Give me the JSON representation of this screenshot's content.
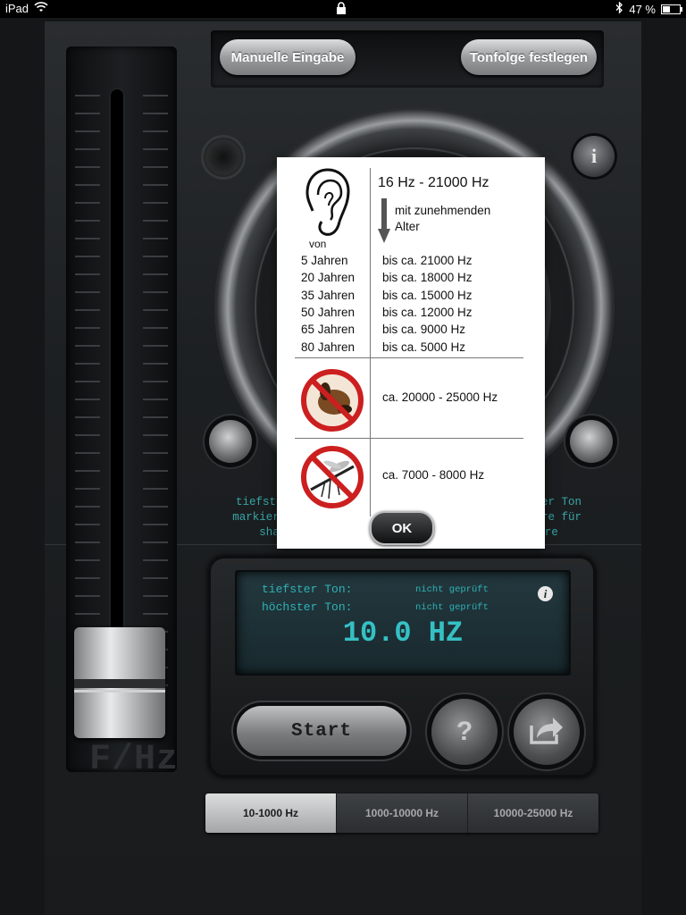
{
  "status_bar": {
    "device": "iPad",
    "battery": "47 %",
    "battery_level": 0.47
  },
  "top_buttons": {
    "manual": "Manuelle Eingabe",
    "sequence": "Tonfolge festlegen"
  },
  "slider": {
    "axis_label": "F/Hz"
  },
  "speaker_labels": {
    "low": "tiefster Ton\nmarkieren für\nshare",
    "high": "höchster Ton\nmarkiere für\nshare"
  },
  "display": {
    "lowest_label": "tiefster Ton:",
    "lowest_value": "nicht geprüft",
    "highest_label": "höchster Ton:",
    "highest_value": "nicht geprüft",
    "frequency": "10.0 HZ"
  },
  "controls": {
    "start": "Start",
    "help": "?"
  },
  "tabs": [
    {
      "label": "10-1000 Hz",
      "active": true
    },
    {
      "label": "1000-10000 Hz",
      "active": false
    },
    {
      "label": "10000-25000 Hz",
      "active": false
    }
  ],
  "dialog": {
    "human_range": "16 Hz - 21000 Hz",
    "age_note_1": "mit zunehmenden",
    "age_note_2": "Alter",
    "from": "von",
    "ages": [
      {
        "age": "5 Jahren",
        "range": "bis ca. 21000 Hz"
      },
      {
        "age": "20 Jahren",
        "range": "bis ca. 18000 Hz"
      },
      {
        "age": "35 Jahren",
        "range": "bis ca. 15000 Hz"
      },
      {
        "age": "50 Jahren",
        "range": "bis ca. 12000 Hz"
      },
      {
        "age": "65 Jahren",
        "range": "bis ca. 9000 Hz"
      },
      {
        "age": "80 Jahren",
        "range": "bis ca. 5000 Hz"
      }
    ],
    "dog_range": "ca. 20000 - 25000 Hz",
    "mosquito_range": "ca. 7000 - 8000 Hz",
    "ok": "OK"
  },
  "colors": {
    "accent": "#37a5a8",
    "lcd_text": "#2fb2b6",
    "prohibition_red": "#cc1f1f"
  }
}
